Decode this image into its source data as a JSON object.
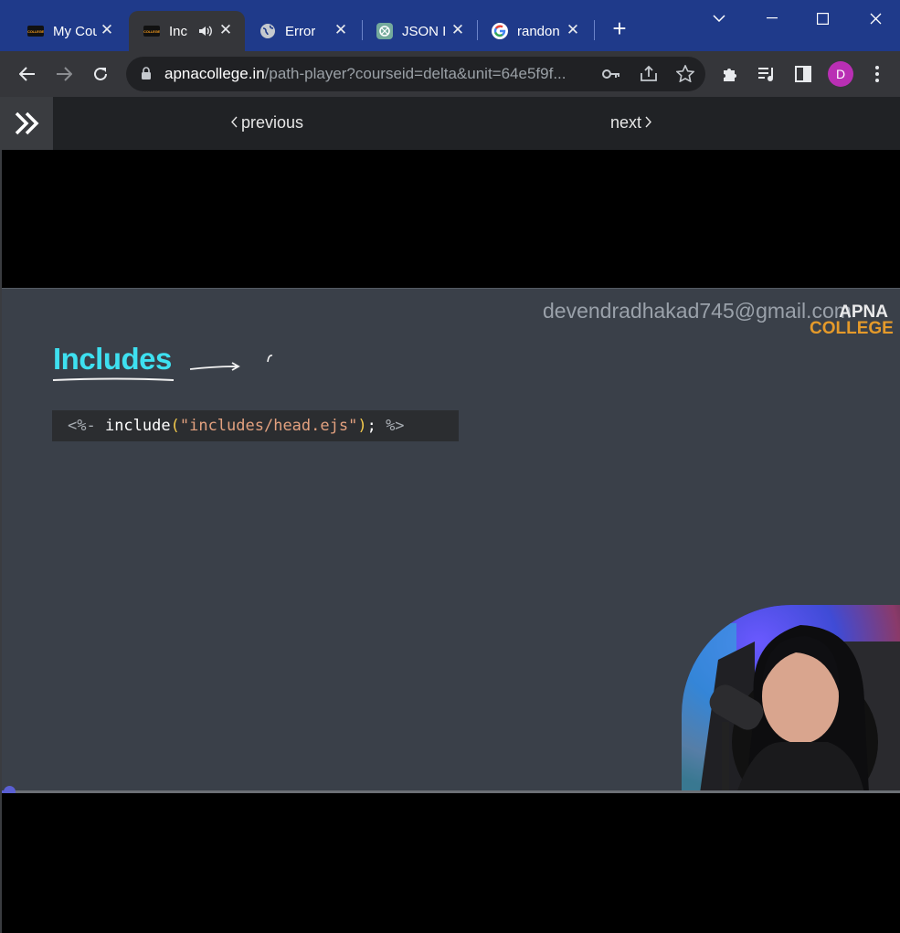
{
  "browser": {
    "tabs": [
      {
        "title": "My Cou",
        "favicon": "apna-college-icon",
        "active": false
      },
      {
        "title": "Inc",
        "favicon": "apna-college-icon",
        "active": true,
        "audio": true
      },
      {
        "title": "Error",
        "favicon": "globe-icon",
        "active": false
      },
      {
        "title": "JSON In",
        "favicon": "chatgpt-icon",
        "active": false
      },
      {
        "title": "randon",
        "favicon": "google-icon",
        "active": false
      }
    ],
    "favicon_text": "COLLEGE",
    "url_host": "apnacollege.in",
    "url_path": "/path-player?courseid=delta&unit=64e5f9f...",
    "profile_initial": "D",
    "colors": {
      "tabstrip": "#1f3a8a",
      "toolbar": "#35363a",
      "avatar": "#b92fb4"
    }
  },
  "player": {
    "prev_label": "previous",
    "next_label": "next",
    "progress_fraction": 0.005
  },
  "slide": {
    "watermark": "devendradhakad745@gmail.com",
    "logo_line1": "APNA",
    "logo_line2": "COLLEGE",
    "title": "Includes",
    "code": {
      "open": "<%- ",
      "fn": "include",
      "lparen": "(",
      "str": "\"includes/head.ejs\"",
      "rparen": ")",
      "semi": "; ",
      "close": "%>"
    },
    "colors": {
      "title": "#3ee0f0",
      "background": "#3a4049",
      "code_bg": "#2b2d30"
    }
  }
}
